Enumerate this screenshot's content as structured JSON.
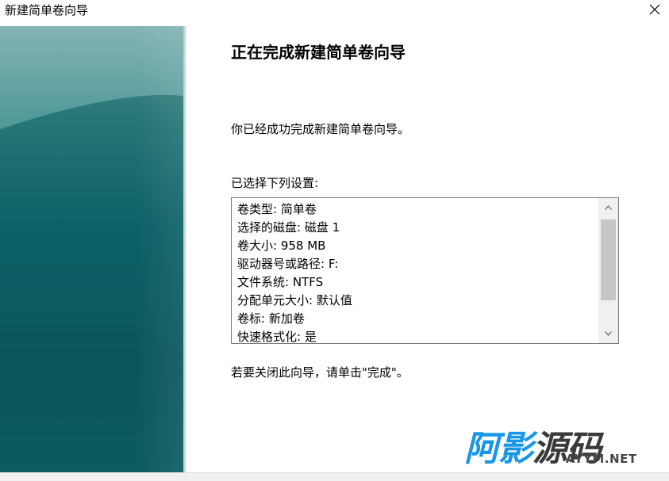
{
  "window": {
    "title": "新建简单卷向导",
    "close_icon": "close-icon"
  },
  "wizard": {
    "heading": "正在完成新建简单卷向导",
    "intro": "你已经成功完成新建简单卷向导。",
    "settings_label": "已选择下列设置:",
    "settings": [
      "卷类型: 简单卷",
      "选择的磁盘: 磁盘 1",
      "卷大小: 958 MB",
      "驱动器号或路径: F:",
      "文件系统: NTFS",
      "分配单元大小: 默认值",
      "卷标: 新加卷",
      "快速格式化: 是"
    ],
    "finish_hint": "若要关闭此向导，请单击\"完成\"。"
  },
  "watermark": {
    "chars": [
      "阿",
      "影",
      "源",
      "码"
    ],
    "domain": "AYYM.NET",
    "colors": {
      "blue": "#1897e8",
      "dark": "#3a3a3a"
    }
  },
  "colors": {
    "banner_teal": "#0f6b70"
  }
}
